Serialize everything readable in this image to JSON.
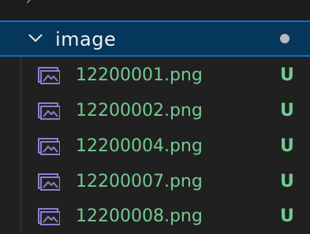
{
  "explorer": {
    "folder": {
      "name": "image",
      "expanded": true,
      "chevron_icon": "chevron-down-icon",
      "status_indicator": "modified-dot"
    },
    "files": [
      {
        "name": "12200001.png",
        "status": "U",
        "icon": "image-file-icon"
      },
      {
        "name": "12200002.png",
        "status": "U",
        "icon": "image-file-icon"
      },
      {
        "name": "12200004.png",
        "status": "U",
        "icon": "image-file-icon"
      },
      {
        "name": "12200007.png",
        "status": "U",
        "icon": "image-file-icon"
      },
      {
        "name": "12200008.png",
        "status": "U",
        "icon": "image-file-icon"
      }
    ],
    "colors": {
      "background": "#202020",
      "selected_row": "#05365c",
      "selected_border": "#0f70c4",
      "untracked_text": "#73c991",
      "folder_text": "#f0f0f0",
      "image_icon": "#8a7fd1"
    }
  }
}
